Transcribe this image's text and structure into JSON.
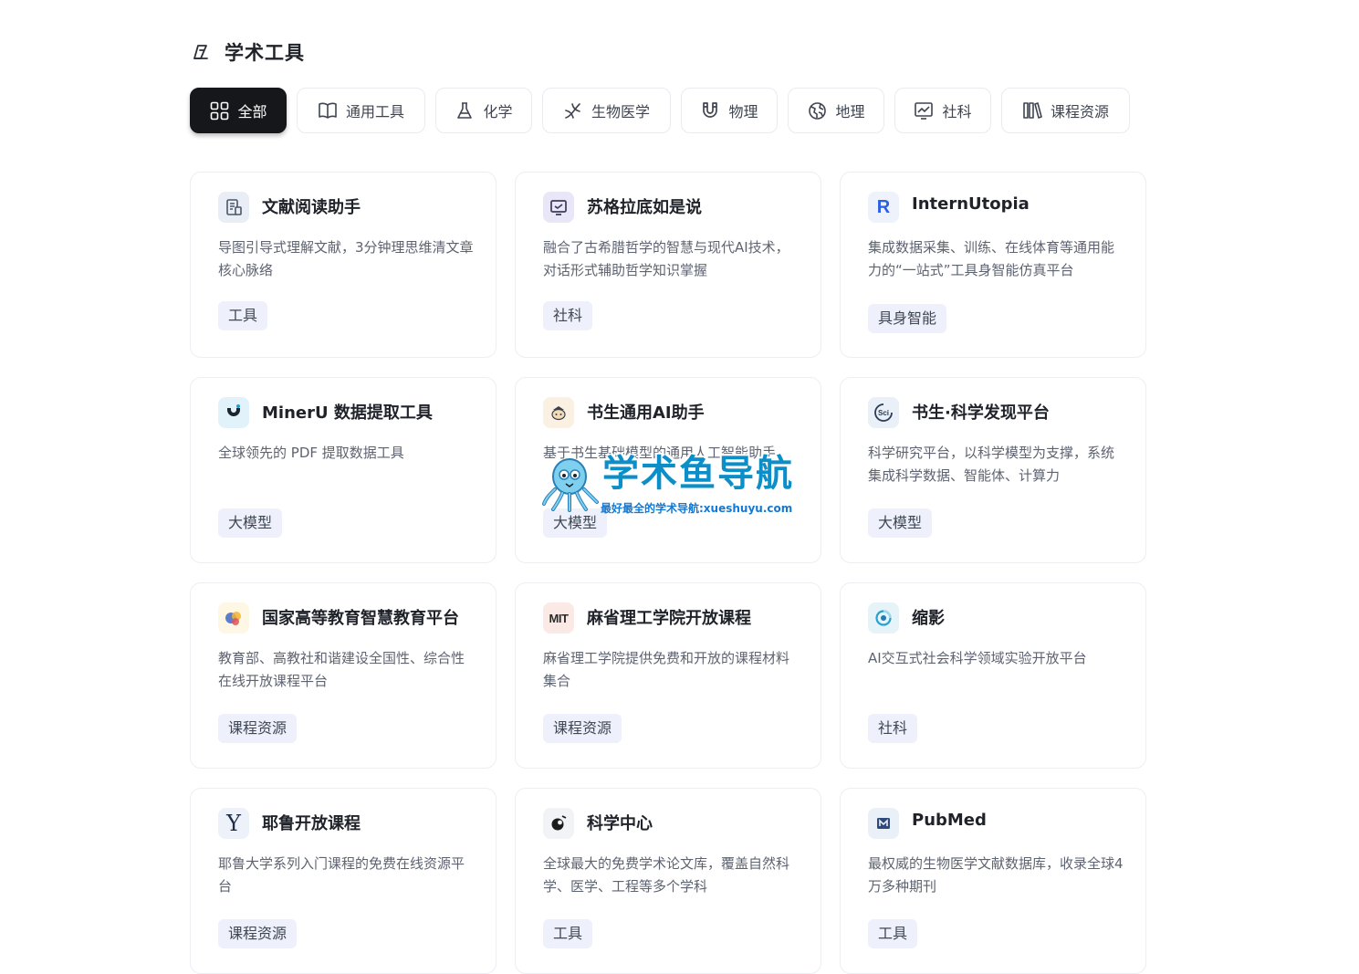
{
  "section": {
    "title": "学术工具",
    "icon": "pen-icon"
  },
  "tabs": [
    {
      "label": "全部",
      "icon": "grid-icon",
      "active": true
    },
    {
      "label": "通用工具",
      "icon": "book-icon",
      "active": false
    },
    {
      "label": "化学",
      "icon": "flask-icon",
      "active": false
    },
    {
      "label": "生物医学",
      "icon": "dna-icon",
      "active": false
    },
    {
      "label": "物理",
      "icon": "magnet-icon",
      "active": false
    },
    {
      "label": "地理",
      "icon": "globe-icon",
      "active": false
    },
    {
      "label": "社科",
      "icon": "chart-frame-icon",
      "active": false
    },
    {
      "label": "课程资源",
      "icon": "library-icon",
      "active": false
    }
  ],
  "cards": [
    {
      "name": "文献阅读助手",
      "desc": "导图引导式理解文献，3分钟理思维清文章核心脉络",
      "tag": "工具",
      "logo": "document-reader-logo"
    },
    {
      "name": "苏格拉底如是说",
      "desc": "融合了古希腊哲学的智慧与现代AI技术，对话形式辅助哲学知识掌握",
      "tag": "社科",
      "logo": "chat-frame-logo"
    },
    {
      "name": "InternUtopia",
      "desc": "集成数据采集、训练、在线体育等通用能力的“一站式”工具身智能仿真平台",
      "tag": "具身智能",
      "logo": "internutopia-logo",
      "logo_text": "R"
    },
    {
      "name": "MinerU 数据提取工具",
      "desc": "全球领先的 PDF 提取数据工具",
      "tag": "大模型",
      "logo": "mineru-logo"
    },
    {
      "name": "书生通用AI助手",
      "desc": "基于书生基础模型的通用人工智能助手",
      "tag": "大模型",
      "logo": "intern-assistant-logo"
    },
    {
      "name": "书生·科学发现平台",
      "desc": "科学研究平台，以科学模型为支撑，系统集成科学数据、智能体、计算力",
      "tag": "大模型",
      "logo": "sci-logo",
      "logo_text": "Sci"
    },
    {
      "name": "国家高等教育智慧教育平台",
      "desc": "教育部、高教社和谐建设全国性、综合性在线开放课程平台",
      "tag": "课程资源",
      "logo": "smart-education-logo"
    },
    {
      "name": "麻省理工学院开放课程",
      "desc": "麻省理工学院提供免费和开放的课程材料集合",
      "tag": "课程资源",
      "logo": "mit-logo",
      "logo_text": "MIT"
    },
    {
      "name": "缩影",
      "desc": "AI交互式社会科学领域实验开放平台",
      "tag": "社科",
      "logo": "suoying-logo"
    },
    {
      "name": "耶鲁开放课程",
      "desc": "耶鲁大学系列入门课程的免费在线资源平台",
      "tag": "课程资源",
      "logo": "yale-logo",
      "logo_text": "Y"
    },
    {
      "name": "科学中心",
      "desc": "全球最大的免费学术论文库，覆盖自然科学、医学、工程等多个学科",
      "tag": "工具",
      "logo": "sci-hub-logo"
    },
    {
      "name": "PubMed",
      "desc": "最权威的生物医学文献数据库，收录全球4万多种期刊",
      "tag": "工具",
      "logo": "pubmed-logo"
    }
  ],
  "watermark": {
    "title": "学术鱼导航",
    "subtitle": "最好最全的学术导航:xueshuyu.com",
    "icon": "octopus-mascot-icon"
  },
  "colors": {
    "active_tab_bg": "#15171a",
    "tag_bg": "#eef1fb",
    "brand_blue": "#0c8fc9"
  }
}
